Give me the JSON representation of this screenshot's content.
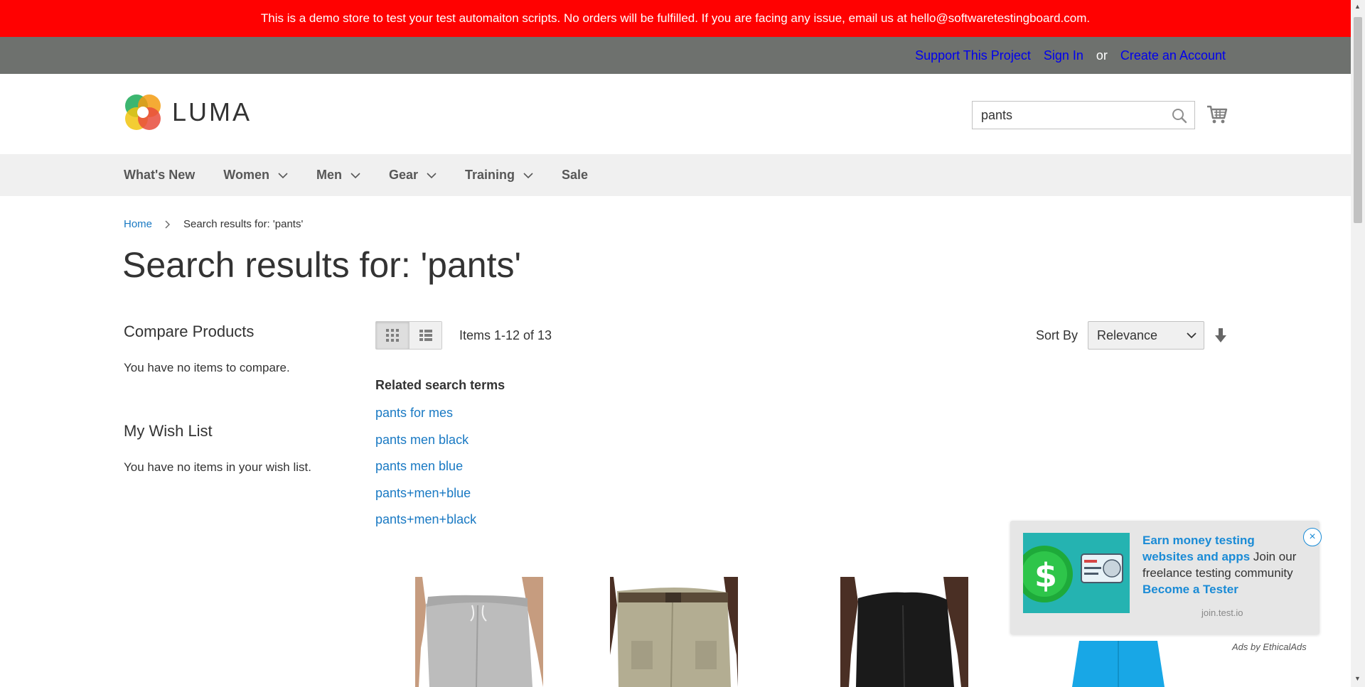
{
  "banner": {
    "text": "This is a demo store to test your test automaiton scripts. No orders will be fulfilled. If you are facing any issue, email us at hello@softwaretestingboard.com."
  },
  "top_links": {
    "support": "Support This Project",
    "sign_in": "Sign In",
    "or": "or",
    "create_account": "Create an Account"
  },
  "header": {
    "logo_text": "LUMA",
    "search_value": "pants",
    "icons": {
      "search": "search-icon",
      "cart": "cart-icon"
    }
  },
  "nav": {
    "items": [
      {
        "label": "What's New",
        "dropdown": false
      },
      {
        "label": "Women",
        "dropdown": true
      },
      {
        "label": "Men",
        "dropdown": true
      },
      {
        "label": "Gear",
        "dropdown": true
      },
      {
        "label": "Training",
        "dropdown": true
      },
      {
        "label": "Sale",
        "dropdown": false
      }
    ]
  },
  "breadcrumbs": {
    "home": "Home",
    "current": "Search results for: 'pants'"
  },
  "page_title": "Search results for: 'pants'",
  "sidebar": {
    "compare_title": "Compare Products",
    "compare_empty": "You have no items to compare.",
    "wishlist_title": "My Wish List",
    "wishlist_empty": "You have no items in your wish list."
  },
  "toolbar": {
    "amount": "Items 1-12 of 13",
    "sort_label": "Sort By",
    "sort_value": "Relevance",
    "view_mode": "grid"
  },
  "related": {
    "title": "Related search terms",
    "terms": [
      "pants for mes",
      "pants men black",
      "pants men blue",
      "pants+men+blue",
      "pants+men+black"
    ]
  },
  "ad": {
    "headline": "Earn money testing websites and apps",
    "body": " Join our freelance testing community ",
    "cta": "Become a Tester",
    "domain": "join.test.io",
    "credit": "Ads by EthicalAds",
    "close": "×"
  },
  "colors": {
    "banner_bg": "#ff0101",
    "top_bar_bg": "#6e716e",
    "nav_bg": "#f0f0f0",
    "link": "#1979c3",
    "ad_highlight": "#1a8bd6"
  }
}
